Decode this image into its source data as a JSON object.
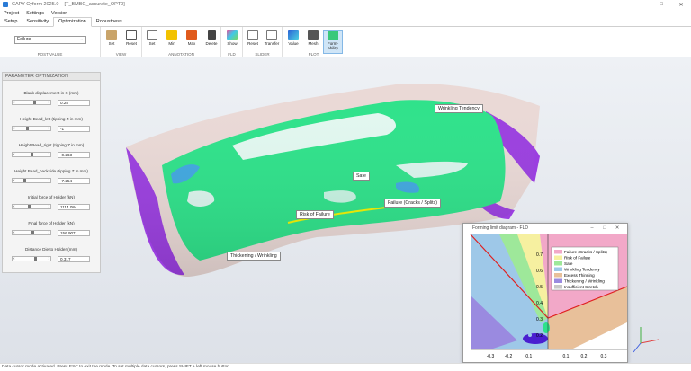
{
  "window": {
    "title": "CAPY-Cyform 2025.0 – [T_BMBG_accurate_OPT0]"
  },
  "menu": [
    "Project",
    "Settings",
    "Version"
  ],
  "tabs": [
    "Setup",
    "Sensitivity",
    "Optimization",
    "Robustness"
  ],
  "ribbon": {
    "post_value_select": "Failure",
    "groups": {
      "post_value": "POST VALUE",
      "view": "VIEW",
      "annotation": "ANNOTATION",
      "fld": "FLD",
      "slider": "SLIDER",
      "plot": "PLOT"
    },
    "buttons": {
      "view_set": "Set",
      "view_reset": "Reset",
      "ann_set": "Set",
      "ann_min": "Min",
      "ann_max": "Max",
      "ann_delete": "Delete",
      "fld_show": "Show",
      "slider_reset": "Reset",
      "slider_transfer": "Transfer",
      "plot_value": "Value",
      "plot_mesh": "Mesh",
      "plot_formability": "Form-\nability"
    }
  },
  "panel": {
    "title": "PARAMETER OPTIMIZATION",
    "params": [
      {
        "label": "Blank displacement in X (mm)",
        "value": "0.25",
        "pos": 0.55
      },
      {
        "label": "Height Bead_left (tipping Z in mm)",
        "value": "-1",
        "pos": 0.3
      },
      {
        "label": "Height Bead_right (tipping Z in mm)",
        "value": "-0.263",
        "pos": 0.45
      },
      {
        "label": "Height Bead_backside (tipping Z in mm)",
        "value": "-7.254",
        "pos": 0.2
      },
      {
        "label": "Initial force of Holder (kN)",
        "value": "1114.084",
        "pos": 0.35
      },
      {
        "label": "Final force of Holder (kN)",
        "value": "156.907",
        "pos": 0.5
      },
      {
        "label": "Distance Die to Holder (mm)",
        "value": "0.317",
        "pos": 0.6
      }
    ]
  },
  "callouts": {
    "wrinkling_tendency": "Wrinkling Tendency",
    "safe": "Safe",
    "failure": "Failure (Cracks / Splits)",
    "risk": "Risk of Failure",
    "thickening": "Thickening / Wrinkling"
  },
  "fld": {
    "title": "Forming limit diagram - FLD",
    "legend": [
      {
        "label": "Failure (Cracks / Splits)",
        "color": "#f2a8c8"
      },
      {
        "label": "Risk of Failure",
        "color": "#f6f0a0"
      },
      {
        "label": "Safe",
        "color": "#9ee89a"
      },
      {
        "label": "Wrinkling Tendency",
        "color": "#9ec8e8"
      },
      {
        "label": "Excess Thinning",
        "color": "#e8c09a"
      },
      {
        "label": "Thickening / Wrinkling",
        "color": "#9a8ae0"
      },
      {
        "label": "Insufficient Stretch",
        "color": "#c8c8c8"
      }
    ],
    "x_ticks": [
      "-0.3",
      "-0.2",
      "-0.1",
      "0.1",
      "0.2",
      "0.3"
    ],
    "y_ticks": [
      "0.7",
      "0.6",
      "0.5",
      "0.4",
      "0.3",
      "0.2"
    ]
  },
  "status": "Data cursor mode activated. Press ESC to exit the mode. To set multiple data cursors, press SHIFT + left mouse button."
}
